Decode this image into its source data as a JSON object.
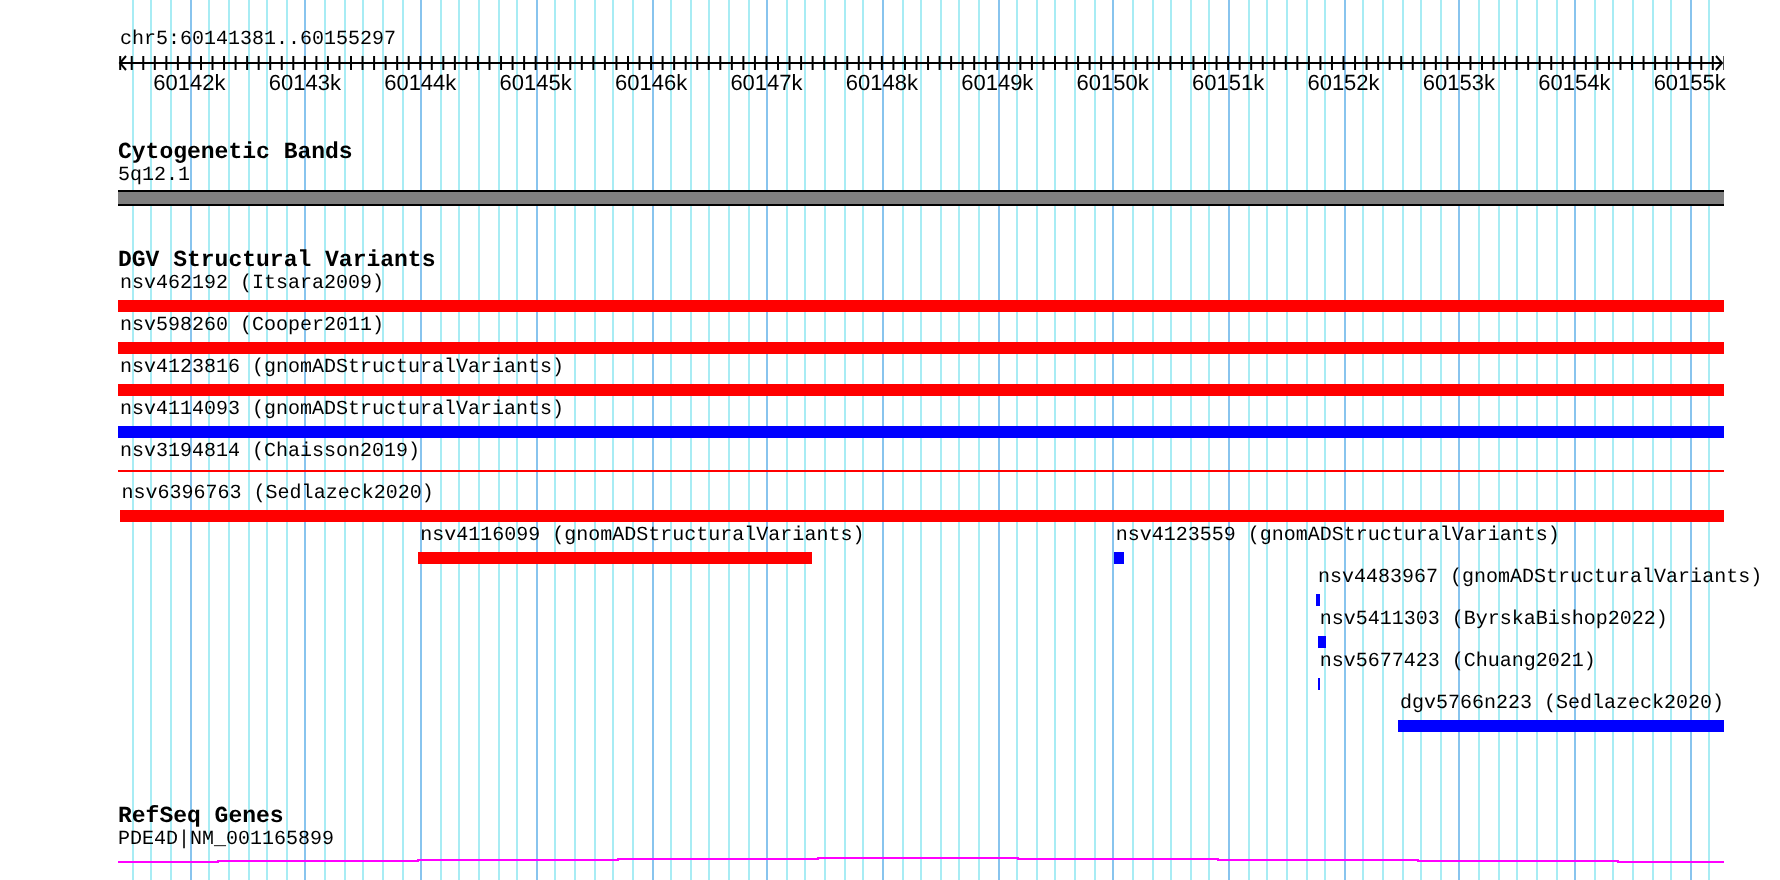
{
  "ruler": {
    "location": "chr5:60141381..60155297",
    "ticks": [
      "60142k",
      "60143k",
      "60144k",
      "60145k",
      "60146k",
      "60147k",
      "60148k",
      "60149k",
      "60150k",
      "60151k",
      "60152k",
      "60153k",
      "60154k",
      "60155k"
    ]
  },
  "cytogenetic_bands": {
    "title": "Cytogenetic Bands",
    "band": "5q12.1"
  },
  "dgv_structural_variants": {
    "title": "DGV Structural Variants",
    "variants": [
      {
        "label": "nsv462192 (Itsara2009)",
        "color": "#ff0000",
        "kind": "bar"
      },
      {
        "label": "nsv598260 (Cooper2011)",
        "color": "#ff0000",
        "kind": "bar"
      },
      {
        "label": "nsv4123816 (gnomADStructuralVariants)",
        "color": "#ff0000",
        "kind": "bar"
      },
      {
        "label": "nsv4114093 (gnomADStructuralVariants)",
        "color": "#0000ff",
        "kind": "bar"
      },
      {
        "label": "nsv3194814 (Chaisson2019)",
        "color": "#ff0000",
        "kind": "line"
      },
      {
        "label": "nsv6396763 (Sedlazeck2020)",
        "color": "#ff0000",
        "kind": "bar"
      },
      {
        "label": "nsv4116099 (gnomADStructuralVariants)",
        "color": "#ff0000",
        "kind": "bar"
      },
      {
        "label": "nsv4123559 (gnomADStructuralVariants)",
        "color": "#0000ff",
        "kind": "bar"
      },
      {
        "label": "nsv4483967 (gnomADStructuralVariants)",
        "color": "#0000ff",
        "kind": "bar"
      },
      {
        "label": "nsv5411303 (ByrskaBishop2022)",
        "color": "#0000ff",
        "kind": "bar"
      },
      {
        "label": "nsv5677423 (Chuang2021)",
        "color": "#0000ff",
        "kind": "bar"
      },
      {
        "label": "dgv5766n223 (Sedlazeck2020)",
        "color": "#0000ff",
        "kind": "bar"
      }
    ]
  },
  "refseq_genes": {
    "title": "RefSeq Genes",
    "gene": "PDE4D|NM_001165899"
  }
}
